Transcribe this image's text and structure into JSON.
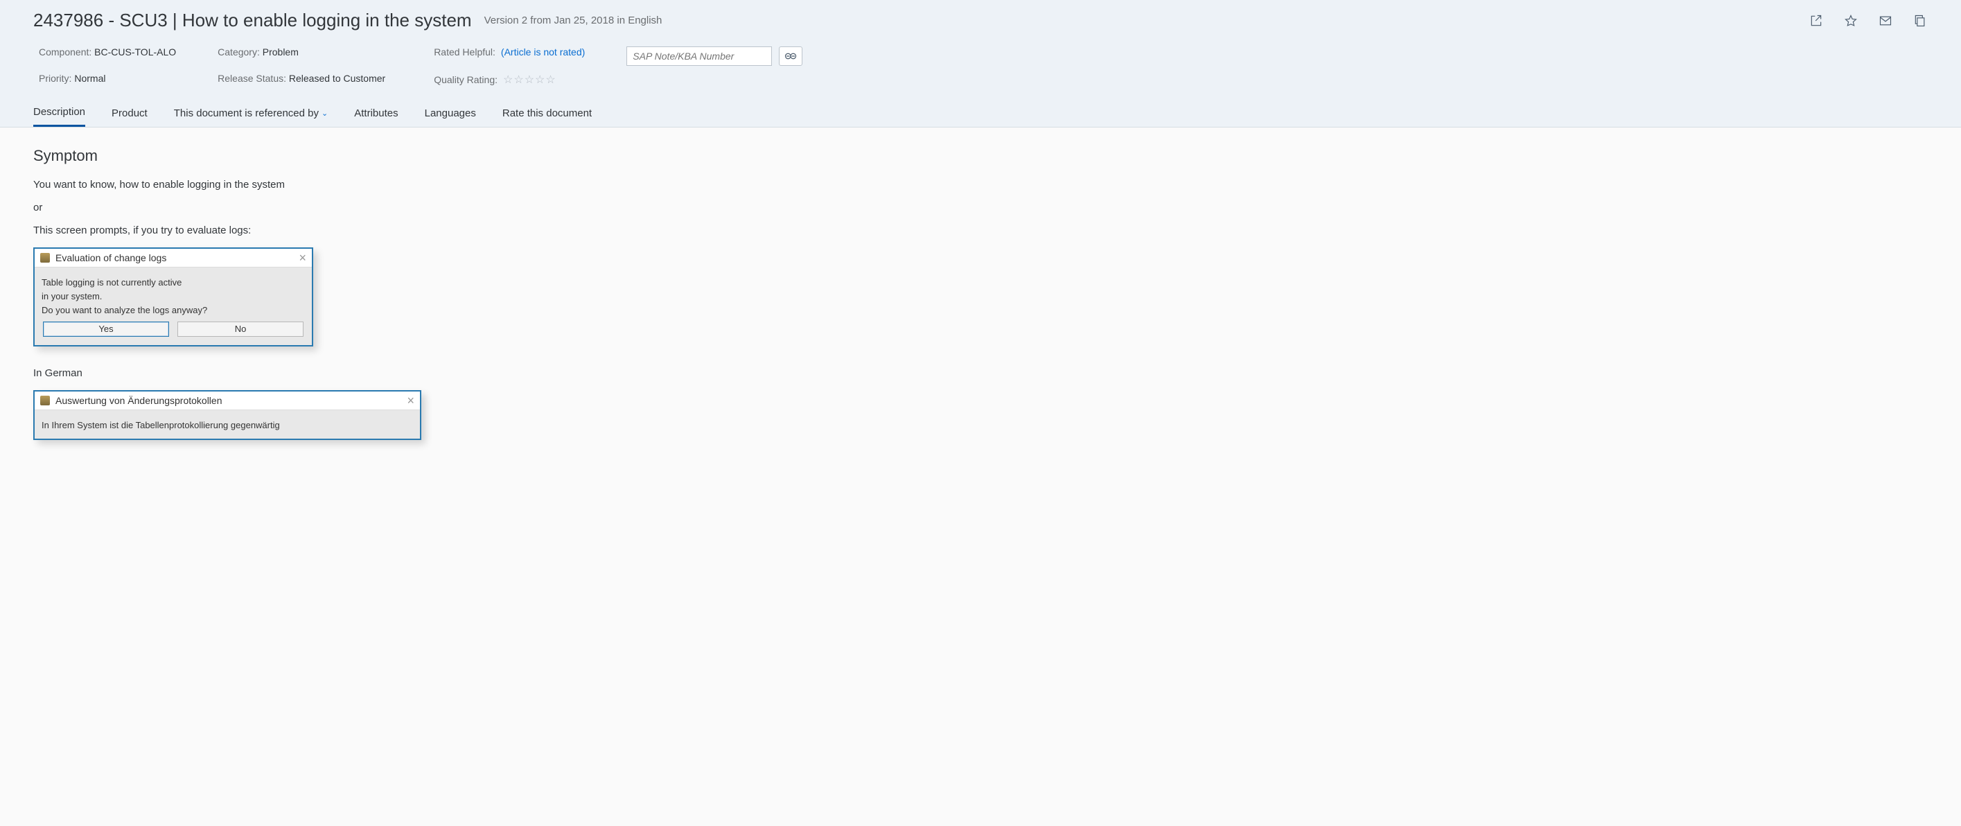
{
  "header": {
    "title": "2437986 - SCU3 | How to enable logging in the system",
    "version": "Version 2 from Jan 25, 2018 in English"
  },
  "meta": {
    "component_label": "Component:",
    "component_value": "BC-CUS-TOL-ALO",
    "priority_label": "Priority:",
    "priority_value": "Normal",
    "category_label": "Category:",
    "category_value": "Problem",
    "release_label": "Release Status:",
    "release_value": "Released to Customer",
    "rated_label": "Rated Helpful:",
    "rated_value": "(Article is not rated)",
    "quality_label": "Quality Rating:",
    "search_placeholder": "SAP Note/KBA Number"
  },
  "tabs": {
    "description": "Description",
    "product": "Product",
    "referenced": "This document is referenced by",
    "attributes": "Attributes",
    "languages": "Languages",
    "rate": "Rate this document"
  },
  "content": {
    "symptom_h": "Symptom",
    "p1": "You want to know, how to enable logging in the system",
    "p2": "or",
    "p3": "This screen prompts, if you try to evaluate logs:",
    "dialog_en": {
      "title": "Evaluation of change logs",
      "line1": "Table logging is not currently active",
      "line2": "in your system.",
      "line3": "Do you want to analyze the logs anyway?",
      "yes": "Yes",
      "no": "No"
    },
    "p_de": "In German",
    "dialog_de": {
      "title": "Auswertung von Änderungsprotokollen",
      "line1": "In Ihrem System ist die Tabellenprotokollierung gegenwärtig"
    }
  }
}
